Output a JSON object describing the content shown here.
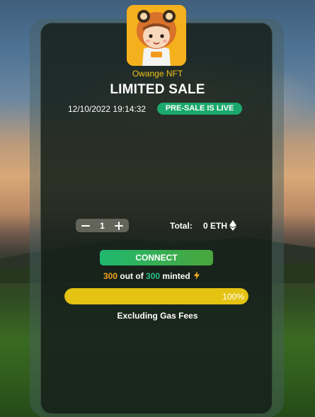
{
  "collection": {
    "name": "Owange NFT"
  },
  "sale": {
    "title": "LIMITED SALE",
    "datetime": "12/10/2022 19:14:32",
    "status_badge": "PRE-SALE IS LIVE"
  },
  "mint": {
    "minus_icon": "minus-icon",
    "plus_icon": "plus-icon",
    "quantity": "1",
    "total_label": "Total:",
    "total_value": "0 ETH",
    "currency_icon": "ethereum-icon"
  },
  "connect_label": "CONNECT",
  "supply": {
    "minted": "300",
    "out_of_text": "out of",
    "max": "300",
    "suffix": "minted",
    "icon": "lightning-icon"
  },
  "progress": {
    "fraction": 1.0,
    "label": "100%"
  },
  "footer": {
    "note": "Excluding Gas Fees"
  },
  "colors": {
    "accent_yellow": "#f0c419",
    "badge_green": "#1aa86c",
    "progress_yellow": "#e4c312",
    "minted_orange": "#f1a21b",
    "max_green": "#27c08a"
  }
}
